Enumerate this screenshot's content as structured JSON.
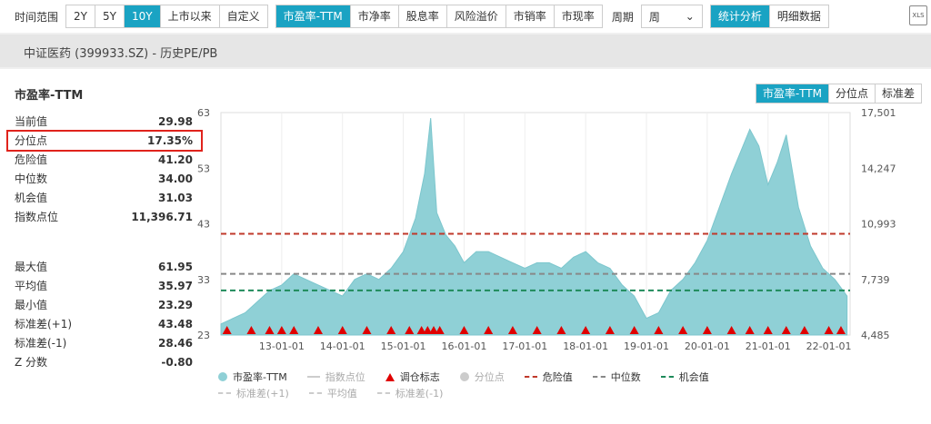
{
  "toolbar": {
    "range_label": "时间范围",
    "ranges": [
      "2Y",
      "5Y",
      "10Y",
      "上市以来",
      "自定义"
    ],
    "active_range": "10Y",
    "metrics": [
      "市盈率-TTM",
      "市净率",
      "股息率",
      "风险溢价",
      "市销率",
      "市现率"
    ],
    "active_metric": "市盈率-TTM",
    "period_label": "周期",
    "period_value": "周",
    "views": [
      "统计分析",
      "明细数据"
    ],
    "active_view": "统计分析",
    "excel_icon": "excel-export-icon"
  },
  "header": {
    "title": "中证医药 (399933.SZ) - 历史PE/PB"
  },
  "panel": {
    "title": "市盈率-TTM",
    "tabs": [
      "市盈率-TTM",
      "分位点",
      "标准差"
    ],
    "active_tab": "市盈率-TTM"
  },
  "stats_top": [
    {
      "label": "当前值",
      "value": "29.98"
    },
    {
      "label": "分位点",
      "value": "17.35%"
    },
    {
      "label": "危险值",
      "value": "41.20"
    },
    {
      "label": "中位数",
      "value": "34.00"
    },
    {
      "label": "机会值",
      "value": "31.03"
    },
    {
      "label": "指数点位",
      "value": "11,396.71"
    }
  ],
  "stats_bottom": [
    {
      "label": "最大值",
      "value": "61.95"
    },
    {
      "label": "平均值",
      "value": "35.97"
    },
    {
      "label": "最小值",
      "value": "23.29"
    },
    {
      "label": "标准差(+1)",
      "value": "43.48"
    },
    {
      "label": "标准差(-1)",
      "value": "28.46"
    },
    {
      "label": "Z 分数",
      "value": "-0.80"
    }
  ],
  "legend": {
    "row1": [
      {
        "label": "市盈率-TTM",
        "kind": "dot",
        "color": "#8fd0d6",
        "dim": false
      },
      {
        "label": "指数点位",
        "kind": "line",
        "color": "#cccccc",
        "dim": true
      },
      {
        "label": "调仓标志",
        "kind": "tri",
        "color": "#e00000",
        "dim": false
      },
      {
        "label": "分位点",
        "kind": "dot",
        "color": "#cccccc",
        "dim": true
      },
      {
        "label": "危险值",
        "kind": "dash",
        "color": "#c0392b",
        "dim": false
      },
      {
        "label": "中位数",
        "kind": "dash",
        "color": "#888888",
        "dim": false
      },
      {
        "label": "机会值",
        "kind": "dash",
        "color": "#1e8a5a",
        "dim": false
      }
    ],
    "row2": [
      {
        "label": "标准差(+1)",
        "kind": "dash",
        "color": "#cccccc",
        "dim": true
      },
      {
        "label": "平均值",
        "kind": "dash",
        "color": "#cccccc",
        "dim": true
      },
      {
        "label": "标准差(-1)",
        "kind": "dash",
        "color": "#cccccc",
        "dim": true
      }
    ]
  },
  "chart_data": {
    "type": "area",
    "x_tick_labels": [
      "13-01-01",
      "14-01-01",
      "15-01-01",
      "16-01-01",
      "17-01-01",
      "18-01-01",
      "19-01-01",
      "20-01-01",
      "21-01-01",
      "22-01-01"
    ],
    "y_left_ticks": [
      23,
      33,
      43,
      53,
      63
    ],
    "y_right_ticks": [
      "4,485",
      "7,739",
      "10,993",
      "14,247",
      "17,501"
    ],
    "ylim": [
      23,
      63
    ],
    "series": [
      {
        "name": "市盈率-TTM",
        "color": "#8fd0d6",
        "x": [
          2012.0,
          2012.2,
          2012.4,
          2012.6,
          2012.8,
          2013.0,
          2013.2,
          2013.4,
          2013.6,
          2013.8,
          2014.0,
          2014.2,
          2014.4,
          2014.6,
          2014.8,
          2015.0,
          2015.2,
          2015.35,
          2015.45,
          2015.55,
          2015.7,
          2015.85,
          2016.0,
          2016.2,
          2016.4,
          2016.6,
          2016.8,
          2017.0,
          2017.2,
          2017.4,
          2017.6,
          2017.8,
          2018.0,
          2018.2,
          2018.4,
          2018.6,
          2018.8,
          2019.0,
          2019.2,
          2019.4,
          2019.6,
          2019.8,
          2020.0,
          2020.2,
          2020.4,
          2020.55,
          2020.7,
          2020.85,
          2021.0,
          2021.15,
          2021.3,
          2021.5,
          2021.7,
          2021.9,
          2022.1,
          2022.3
        ],
        "values": [
          25,
          26,
          27,
          29,
          31,
          32,
          34,
          33,
          32,
          31,
          30,
          33,
          34,
          33,
          35,
          38,
          44,
          52,
          62,
          45,
          41,
          39,
          36,
          38,
          38,
          37,
          36,
          35,
          36,
          36,
          35,
          37,
          38,
          36,
          35,
          32,
          30,
          26,
          27,
          31,
          33,
          36,
          40,
          46,
          52,
          56,
          60,
          57,
          50,
          54,
          59,
          46,
          39,
          35,
          33,
          30
        ]
      }
    ],
    "reference_lines": {
      "危险值": 41.2,
      "中位数": 34.0,
      "机会值": 31.03
    },
    "rebalance_markers_x": [
      2012.1,
      2012.5,
      2012.8,
      2013.0,
      2013.2,
      2013.6,
      2014.0,
      2014.4,
      2014.8,
      2015.1,
      2015.3,
      2015.4,
      2015.5,
      2015.6,
      2016.0,
      2016.4,
      2016.8,
      2017.2,
      2017.6,
      2018.0,
      2018.4,
      2018.8,
      2019.2,
      2019.6,
      2020.0,
      2020.4,
      2020.7,
      2021.0,
      2021.3,
      2021.6,
      2022.0,
      2022.2
    ]
  }
}
